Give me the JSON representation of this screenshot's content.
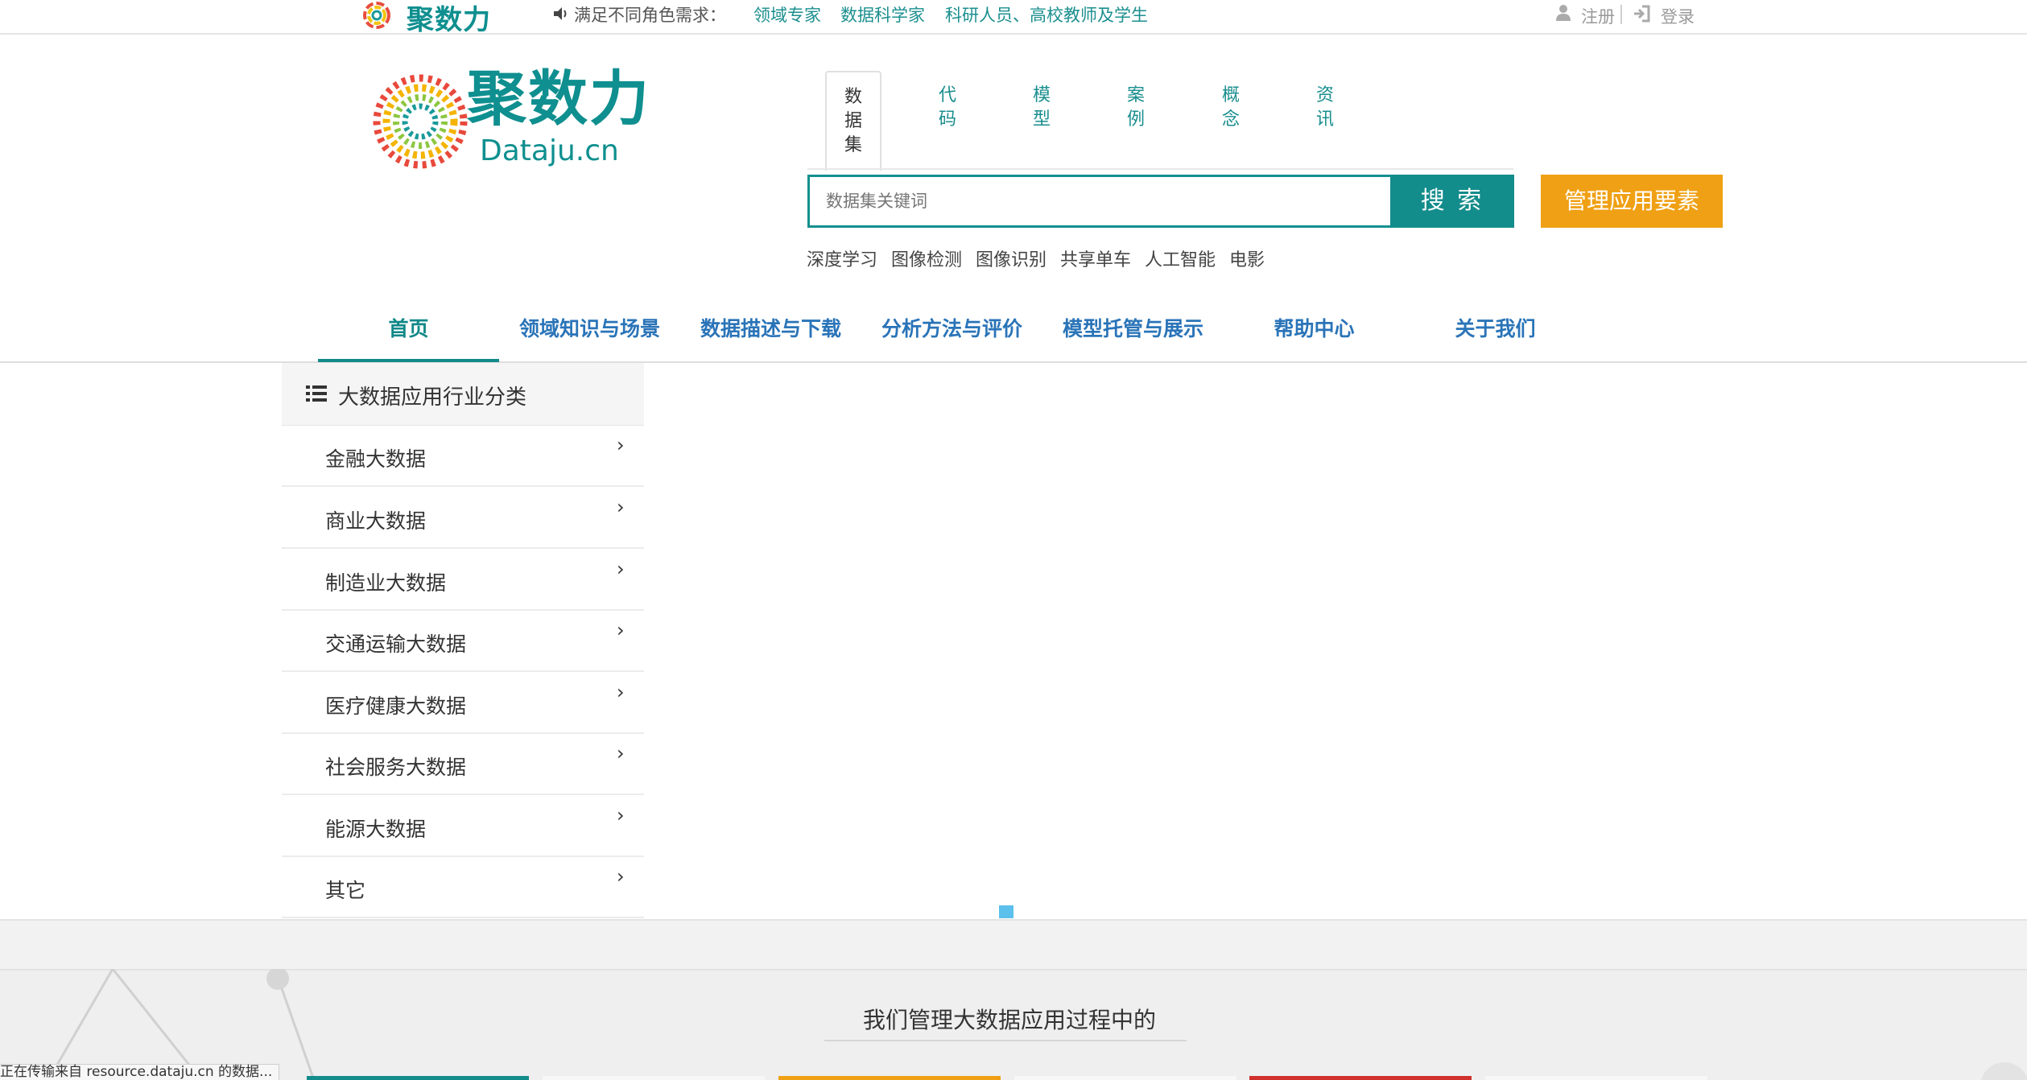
{
  "topbar": {
    "mini_logo_text": "聚数力",
    "slogan": "满足不同角色需求：",
    "roles": [
      "领域专家",
      "数据科学家",
      "科研人员、高校教师及学生"
    ],
    "register": "注册",
    "login": "登录"
  },
  "logo": {
    "cn": "聚数力",
    "en": "Dataju.cn"
  },
  "search": {
    "tabs": [
      {
        "label": "数据集",
        "active": true
      },
      {
        "label": "代码",
        "active": false
      },
      {
        "label": "模型",
        "active": false
      },
      {
        "label": "案例",
        "active": false
      },
      {
        "label": "概念",
        "active": false
      },
      {
        "label": "资讯",
        "active": false
      }
    ],
    "placeholder": "数据集关键词",
    "button": "搜 索",
    "manage_button": "管理应用要素",
    "hot_keywords": [
      "深度学习",
      "图像检测",
      "图像识别",
      "共享单车",
      "人工智能",
      "电影"
    ]
  },
  "nav": {
    "items": [
      {
        "label": "首页",
        "active": true
      },
      {
        "label": "领域知识与场景",
        "active": false
      },
      {
        "label": "数据描述与下载",
        "active": false
      },
      {
        "label": "分析方法与评价",
        "active": false
      },
      {
        "label": "模型托管与展示",
        "active": false
      },
      {
        "label": "帮助中心",
        "active": false
      },
      {
        "label": "关于我们",
        "active": false
      }
    ]
  },
  "sidebar": {
    "title": "大数据应用行业分类",
    "items": [
      "金融大数据",
      "商业大数据",
      "制造业大数据",
      "交通运输大数据",
      "医疗健康大数据",
      "社会服务大数据",
      "能源大数据",
      "其它"
    ]
  },
  "section": {
    "title": "我们管理大数据应用过程中的"
  },
  "statusbar": {
    "text": "正在传输来自 resource.dataju.cn 的数据..."
  },
  "colors": {
    "brand_teal": "#138c8c",
    "accent_orange": "#f0a014",
    "nav_blue": "#2a74b8"
  }
}
